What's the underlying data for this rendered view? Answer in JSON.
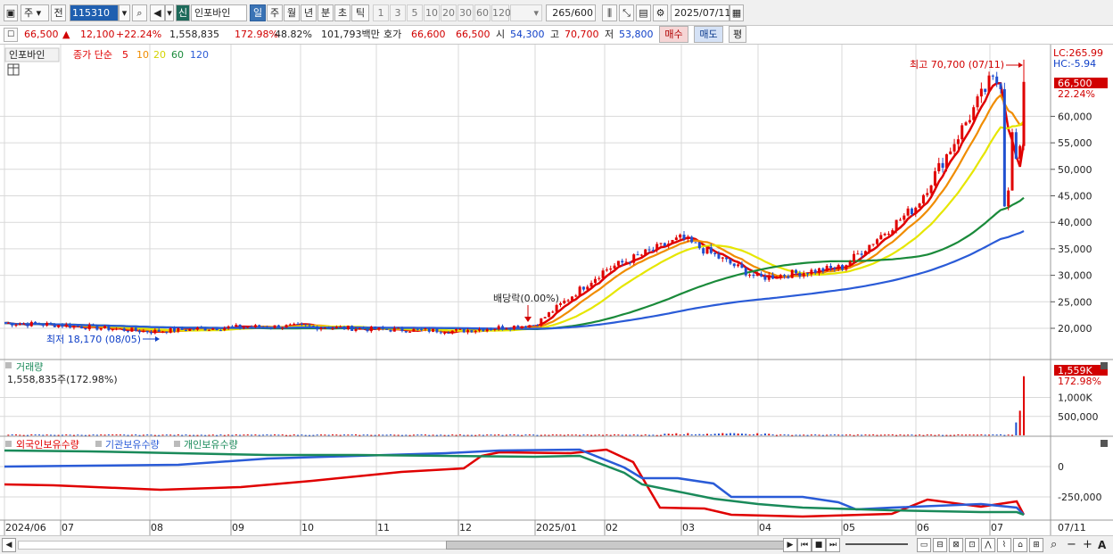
{
  "toolbar": {
    "market_label": "주",
    "prev_label": "전",
    "stock_code": "115310",
    "new_badge": "신",
    "stock_name": "인포바인",
    "periods": [
      "일",
      "주",
      "월",
      "년",
      "분",
      "초",
      "틱"
    ],
    "selected_period": "일",
    "intervals": [
      "1",
      "3",
      "5",
      "10",
      "20",
      "30",
      "60",
      "120"
    ],
    "count_shown": "265",
    "count_total": "/600",
    "date": "2025/07/11"
  },
  "quote": {
    "price": "66,500",
    "change_arrow": "▲",
    "change": "12,100",
    "change_pct": "+22.24%",
    "volume": "1,558,835",
    "volume_ratio": "172.98%",
    "turnover": "48.82%",
    "amount": "101,793백만",
    "hoga_label": "호가",
    "ask": "66,600",
    "bid": "66,500",
    "open_label": "시",
    "open": "54,300",
    "high_label": "고",
    "high": "70,700",
    "low_label": "저",
    "low": "53,800",
    "buy_label": "매수",
    "sell_label": "매도",
    "eval_label": "평"
  },
  "price_panel": {
    "legend_name": "인포바인",
    "ma_title": "종가 단순",
    "ma_periods": [
      {
        "label": "5",
        "color": "#e00000"
      },
      {
        "label": "10",
        "color": "#f08c00"
      },
      {
        "label": "20",
        "color": "#e6e600"
      },
      {
        "label": "60",
        "color": "#1a8a3a"
      },
      {
        "label": "120",
        "color": "#2a5bd7"
      }
    ],
    "lc_label": "LC:265.99",
    "hc_label": "HC:-5.94",
    "current_price_tag": "66,500",
    "current_pct_tag": "22.24%",
    "y_ticks": [
      "60,000",
      "55,000",
      "50,000",
      "45,000",
      "40,000",
      "35,000",
      "30,000",
      "25,000",
      "20,000"
    ],
    "high_annotation": "최고 70,700 (07/11)",
    "low_annotation": "최저 18,170 (08/05)",
    "dividend_annotation": "배당락(0.00%)"
  },
  "volume_panel": {
    "title": "거래량",
    "value": "1,558,835주(172.98%)",
    "tag": "1,559K",
    "tag_pct": "172.98%",
    "y_ticks": [
      "1,000K",
      "500,000"
    ]
  },
  "holding_panel": {
    "legend": [
      {
        "label": "외국인보유수량",
        "color": "#e00000"
      },
      {
        "label": "기관보유수량",
        "color": "#2a5bd7"
      },
      {
        "label": "개인보유수량",
        "color": "#1a8a5a"
      }
    ],
    "y_ticks": [
      "0",
      "-250,000"
    ]
  },
  "x_axis": {
    "labels": [
      "2024/06",
      "07",
      "08",
      "09",
      "10",
      "11",
      "12",
      "2025/01",
      "02",
      "03",
      "04",
      "05",
      "06",
      "07"
    ],
    "right_label": "07/11"
  },
  "chart_data": {
    "type": "line",
    "price": {
      "x": [
        "2024/06",
        "2024/07",
        "2024/08",
        "2024/09",
        "2024/10",
        "2024/11",
        "2024/12",
        "2025/01",
        "2025/02",
        "2025/03",
        "2025/04",
        "2025/05",
        "2025/06",
        "2025/07"
      ],
      "close_approx": [
        21000,
        20600,
        19400,
        20200,
        20400,
        19800,
        19500,
        20700,
        31000,
        37000,
        29500,
        31500,
        43000,
        66500
      ],
      "high": 70700,
      "low": 18170
    },
    "ylim_price": [
      18000,
      70000
    ],
    "volume_last": 1558835,
    "ylim_volume": [
      0,
      1600000
    ]
  },
  "colors": {
    "ma5": "#e00000",
    "ma10": "#f08c00",
    "ma20": "#e6e600",
    "ma60": "#1a8a3a",
    "ma120": "#2a5bd7",
    "up": "#e00000",
    "down": "#2050d0",
    "grid": "#d9d9d9"
  }
}
